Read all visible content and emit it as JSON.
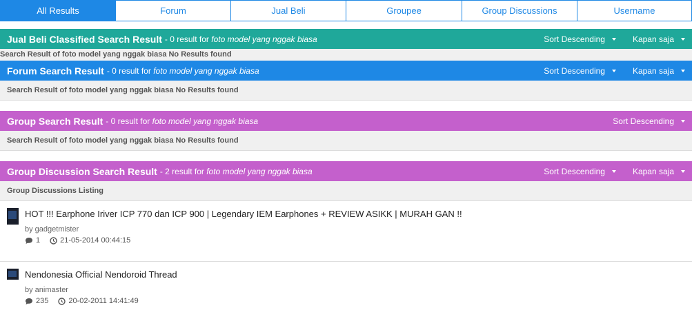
{
  "tabs": [
    {
      "label": "All Results",
      "active": true
    },
    {
      "label": "Forum",
      "active": false
    },
    {
      "label": "Jual Beli",
      "active": false
    },
    {
      "label": "Groupee",
      "active": false
    },
    {
      "label": "Group Discussions",
      "active": false
    },
    {
      "label": "Username",
      "active": false
    }
  ],
  "jualbeli": {
    "title": "Jual Beli Classified Search Result",
    "meta_prefix": "- 0 result for",
    "query": "foto model yang nggak biasa",
    "sort": "Sort Descending",
    "time": "Kapan saja",
    "message": "Search Result of foto model yang nggak biasa No Results found"
  },
  "forum": {
    "title": "Forum Search Result",
    "meta_prefix": "- 0 result for",
    "query": "foto model yang nggak biasa",
    "sort": "Sort Descending",
    "time": "Kapan saja",
    "message": "Search Result of foto model yang nggak biasa No Results found"
  },
  "group": {
    "title": "Group Search Result",
    "meta_prefix": "- 0 result for",
    "query": "foto model yang nggak biasa",
    "sort": "Sort Descending",
    "message": "Search Result of foto model yang nggak biasa No Results found"
  },
  "discussion": {
    "title": "Group Discussion Search Result",
    "meta_prefix": "- 2 result for",
    "query": "foto model yang nggak biasa",
    "sort": "Sort Descending",
    "time": "Kapan saja",
    "listing_label": "Group Discussions Listing",
    "items": [
      {
        "title": "HOT !!! Earphone Iriver ICP 770 dan ICP 900 | Legendary IEM Earphones + REVIEW ASIKK | MURAH GAN !!",
        "author": "by gadgetmister",
        "comments": "1",
        "date": "21-05-2014 00:44:15"
      },
      {
        "title": "Nendonesia Official Nendoroid Thread",
        "author": "by animaster",
        "comments": "235",
        "date": "20-02-2011 14:41:49"
      }
    ]
  },
  "colors": {
    "green": "#1fa89a",
    "blue": "#1e88e5",
    "purple": "#c460cc"
  },
  "icons": {
    "comment": "comment-icon",
    "clock": "clock-icon",
    "caret": "caret-down-icon"
  }
}
